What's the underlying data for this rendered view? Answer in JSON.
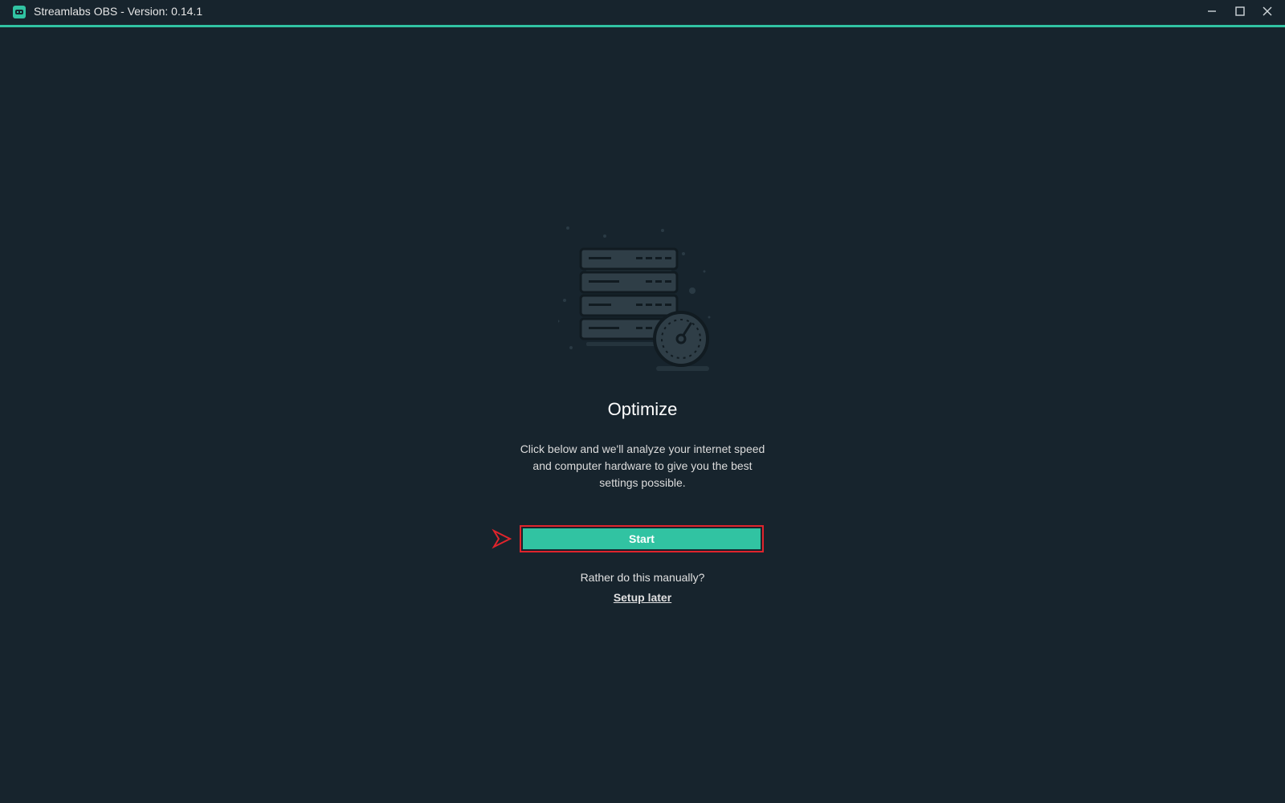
{
  "window": {
    "title": "Streamlabs OBS - Version: 0.14.1",
    "app_icon": "streamlabs-logo-icon",
    "controls": [
      "minimize-icon",
      "maximize-icon",
      "close-icon"
    ],
    "accent_color": "#31c3a2",
    "background_color": "#17242d"
  },
  "main": {
    "illustration": "server-speedometer-icon",
    "heading": "Optimize",
    "description": "Click below and we'll analyze your internet speed and computer hardware to give you the best settings possible.",
    "start_label": "Start",
    "manual_prompt": "Rather do this manually?",
    "setup_later_label": "Setup later",
    "highlight_color": "#e0242c",
    "pointer_icon": "arrow-pointer-icon"
  }
}
